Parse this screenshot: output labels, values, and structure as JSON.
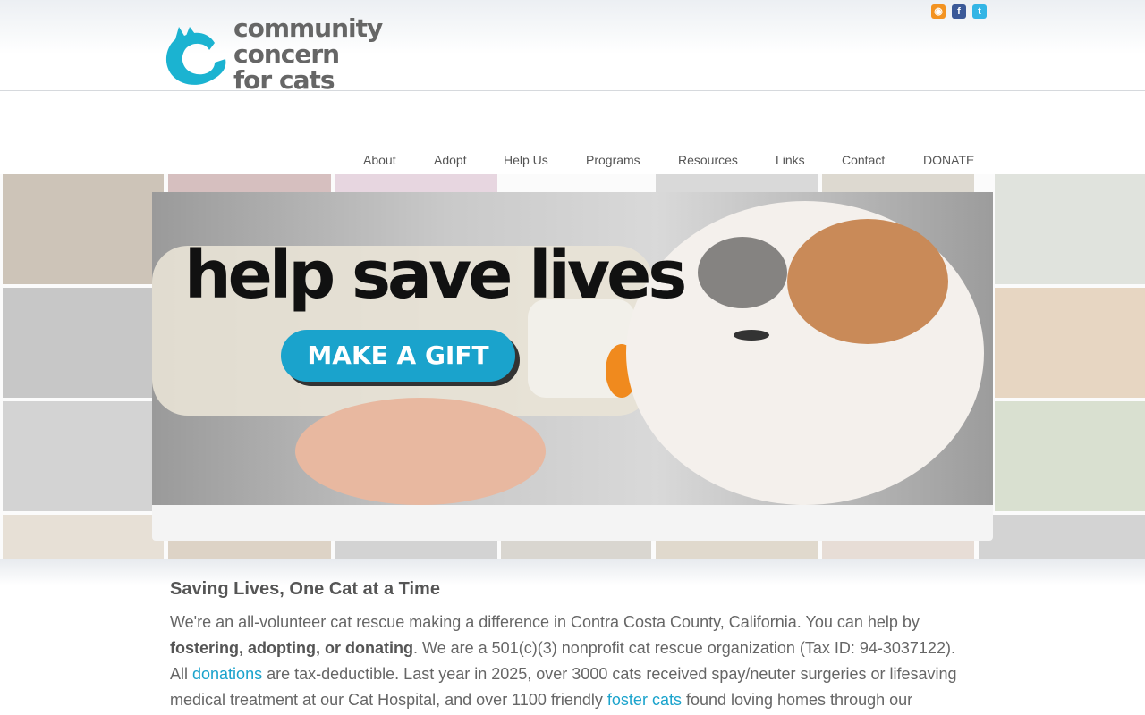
{
  "header": {
    "logo_lines": [
      "community",
      "concern",
      "for cats"
    ],
    "brand_color": "#1bb3d1",
    "social": [
      {
        "name": "rss-icon",
        "glyph": "◉"
      },
      {
        "name": "facebook-icon",
        "glyph": "f"
      },
      {
        "name": "twitter-icon",
        "glyph": "t"
      }
    ]
  },
  "nav": {
    "items": [
      "About",
      "Adopt",
      "Help Us",
      "Programs",
      "Resources",
      "Links",
      "Contact",
      "DONATE"
    ]
  },
  "hero": {
    "headline": "help save lives",
    "button_label": "MAKE A GIFT",
    "button_color": "#1aa3cc"
  },
  "content": {
    "heading": "Saving Lives, One Cat at a Time",
    "p1_part1": "We're an all-volunteer cat rescue making a difference in Contra Costa County, California. You can help by ",
    "p1_bold": "fostering, adopting, or donating",
    "p1_part2": ". We are a 501(c)(3) nonprofit cat rescue organization (Tax ID: 94-3037122). All ",
    "p1_link1": "donations",
    "p1_part3": " are tax-deductible. Last year in 2025, over 3000 cats received spay/neuter surgeries or lifesaving medical treatment at our Cat Hospital, and over 1100 friendly ",
    "p1_link2": "foster cats",
    "p1_part4": " found loving homes through our"
  }
}
